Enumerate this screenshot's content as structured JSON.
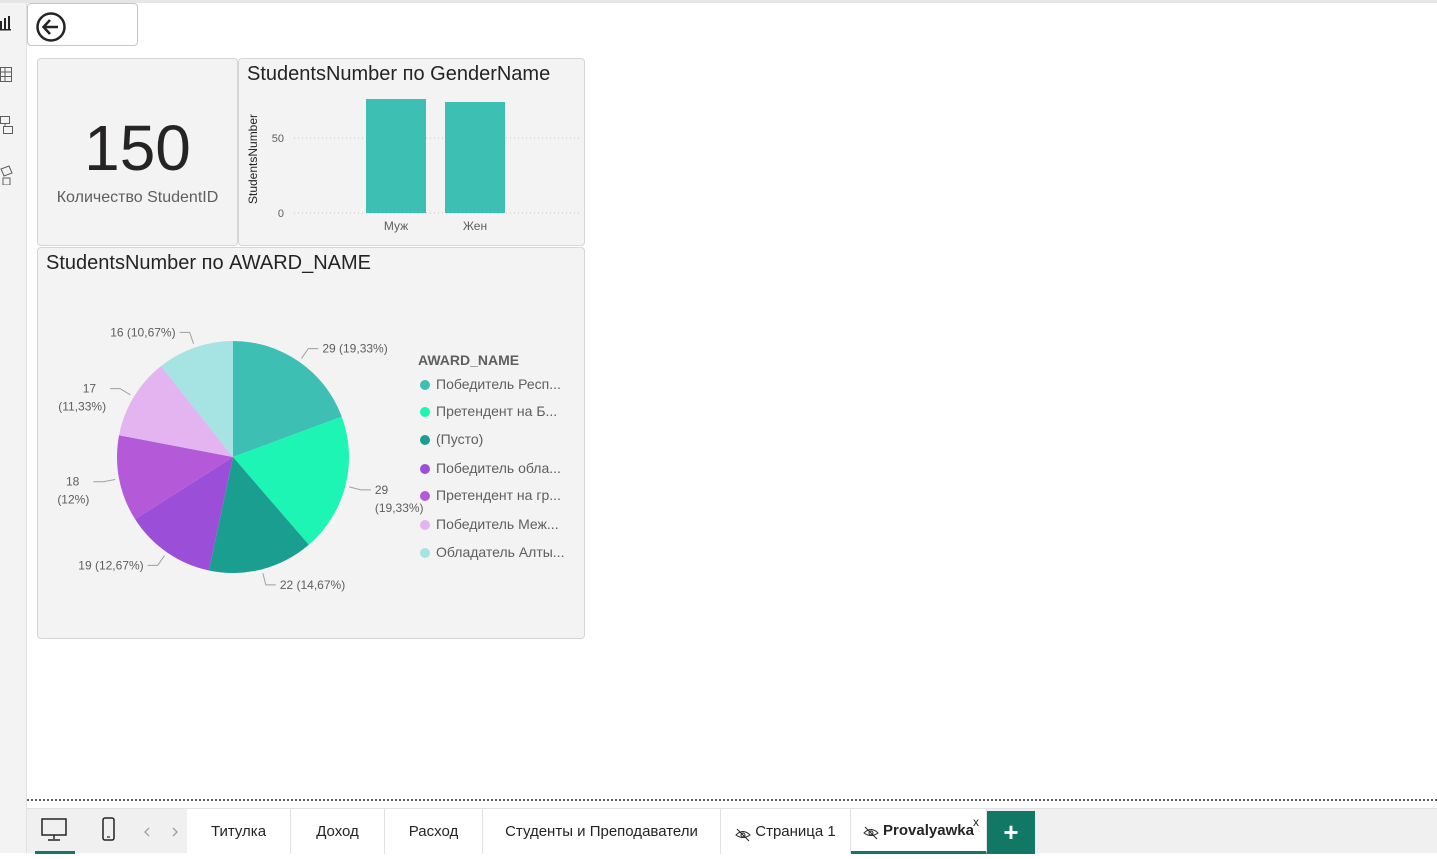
{
  "card": {
    "value": "150",
    "label": "Количество StudentID"
  },
  "bar_visual": {
    "title": "StudentsNumber по GenderName",
    "ylabel": "StudentsNumber"
  },
  "pie_visual": {
    "title": "StudentsNumber по AWARD_NAME",
    "legend_title": "AWARD_NAME",
    "legend": [
      {
        "label": "Победитель Респ...",
        "color": "#3dbfb4"
      },
      {
        "label": "Претендент на Б...",
        "color": "#1cf5b4"
      },
      {
        "label": "(Пусто)",
        "color": "#1a9e90"
      },
      {
        "label": "Победитель обла...",
        "color": "#9b4fd8"
      },
      {
        "label": "Претендент на гр...",
        "color": "#b45ad8"
      },
      {
        "label": "Победитель Меж...",
        "color": "#e3b4f0"
      },
      {
        "label": "Обладатель Алты...",
        "color": "#a6e3e3"
      }
    ]
  },
  "chart_data": [
    {
      "type": "bar",
      "title": "StudentsNumber по GenderName",
      "xlabel": "",
      "ylabel": "StudentsNumber",
      "categories": [
        "Муж",
        "Жен"
      ],
      "values": [
        76,
        74
      ],
      "yticks": [
        0,
        50
      ],
      "ylim": [
        0,
        80
      ],
      "grid": true,
      "color": "#3dbfb4"
    },
    {
      "type": "pie",
      "title": "StudentsNumber по AWARD_NAME",
      "categories": [
        "Победитель Респ...",
        "Претендент на Б...",
        "(Пусто)",
        "Победитель обла...",
        "Претендент на гр...",
        "Победитель Меж...",
        "Обладатель Алты..."
      ],
      "values": [
        29,
        29,
        22,
        19,
        18,
        17,
        16
      ],
      "data_labels": [
        "29 (19,33%)",
        "29 (19,33%)",
        "22 (14,67%)",
        "19 (12,67%)",
        "18 (12%)",
        "17 (11,33%)",
        "16 (10,67%)"
      ],
      "colors": [
        "#3dbfb4",
        "#1cf5b4",
        "#1a9e90",
        "#9b4fd8",
        "#b45ad8",
        "#e3b4f0",
        "#a6e3e3"
      ],
      "legend_position": "right"
    }
  ],
  "pages": {
    "tabs": [
      {
        "label": "Титулка",
        "hidden": false,
        "active": false
      },
      {
        "label": "Доход",
        "hidden": false,
        "active": false
      },
      {
        "label": "Расход",
        "hidden": false,
        "active": false
      },
      {
        "label": "Студенты и Преподаватели",
        "hidden": false,
        "active": false
      },
      {
        "label": "Страница 1",
        "hidden": true,
        "active": false
      },
      {
        "label": "Provalyawka",
        "hidden": true,
        "active": true
      }
    ],
    "add_label": "+",
    "close_label": "x"
  }
}
